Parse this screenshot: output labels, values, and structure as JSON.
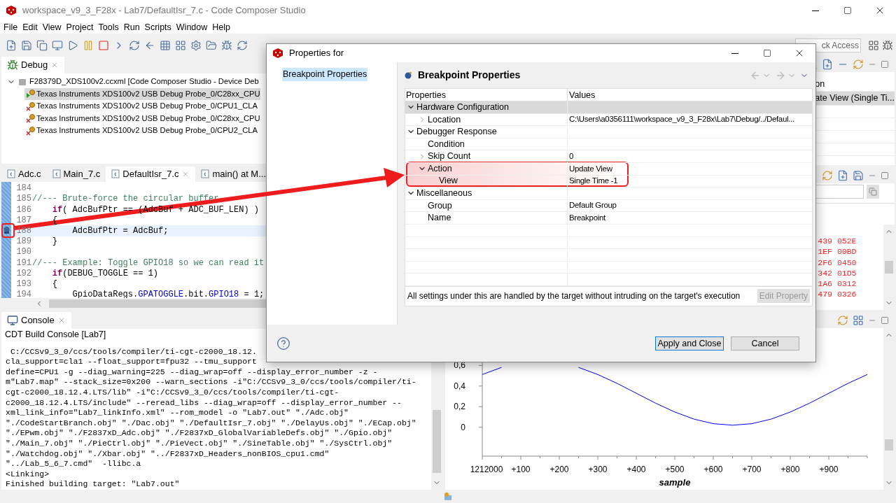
{
  "window": {
    "title": "workspace_v9_3_F28x - Lab7/DefaultIsr_7.c - Code Composer Studio"
  },
  "menu": [
    "File",
    "Edit",
    "View",
    "Project",
    "Tools",
    "Run",
    "Scripts",
    "Window",
    "Help"
  ],
  "quick_access": {
    "placeholder": "ck Access"
  },
  "debug_view": {
    "tab": "Debug",
    "root": {
      "label": "F28379D_XDS100v2.ccxml [Code Composer Studio - Device Deb",
      "expanded": true,
      "children": [
        {
          "label": "Texas Instruments XDS100v2 USB Debug Probe_0/C28xx_CPU",
          "selected": true,
          "kind": "running"
        },
        {
          "label": "Texas Instruments XDS100v2 USB Debug Probe_0/CPU1_CLA",
          "selected": false,
          "kind": "disconnected"
        },
        {
          "label": "Texas Instruments XDS100v2 USB Debug Probe_0/C28xx_CPU",
          "selected": false,
          "kind": "disconnected"
        },
        {
          "label": "Texas Instruments XDS100v2 USB Debug Probe_0/CPU2_CLA",
          "selected": false,
          "kind": "disconnected"
        }
      ]
    }
  },
  "editor": {
    "tabs": [
      {
        "label": "Adc.c",
        "selected": false
      },
      {
        "label": "Main_7.c",
        "selected": false
      },
      {
        "label": "DefaultIsr_7.c",
        "selected": true
      },
      {
        "label": "main() at M...",
        "selected": false
      }
    ],
    "lines": [
      {
        "number": "184",
        "current": false,
        "breakpoint": false
      },
      {
        "number": "185",
        "current": false,
        "breakpoint": false,
        "segments": [
          {
            "kind": "comment",
            "text": "//--- Brute-force the circular buffer"
          }
        ]
      },
      {
        "number": "186",
        "current": false,
        "breakpoint": false,
        "segments": [
          {
            "kind": "keyword",
            "text": "    if"
          },
          {
            "kind": "plain",
            "text": "( AdcBufPtr == (AdcBuf + ADC_BUF_LEN) )"
          }
        ]
      },
      {
        "number": "187",
        "current": false,
        "breakpoint": false,
        "segments": [
          {
            "kind": "plain",
            "text": "    {"
          }
        ]
      },
      {
        "number": "188",
        "current": true,
        "breakpoint": true,
        "segments": [
          {
            "kind": "plain",
            "text": "        AdcBufPtr = AdcBuf;"
          }
        ]
      },
      {
        "number": "189",
        "current": false,
        "breakpoint": false,
        "segments": [
          {
            "kind": "plain",
            "text": "    }"
          }
        ]
      },
      {
        "number": "190",
        "current": false,
        "breakpoint": false
      },
      {
        "number": "191",
        "current": false,
        "breakpoint": false,
        "segments": [
          {
            "kind": "comment",
            "text": "//--- Example: Toggle GPIO18 so we can read it"
          }
        ]
      },
      {
        "number": "192",
        "current": false,
        "breakpoint": false,
        "segments": [
          {
            "kind": "keyword",
            "text": "    if"
          },
          {
            "kind": "plain",
            "text": "(DEBUG_TOGGLE == 1)"
          }
        ]
      },
      {
        "number": "193",
        "current": false,
        "breakpoint": false,
        "segments": [
          {
            "kind": "plain",
            "text": "    {"
          }
        ]
      },
      {
        "number": "194",
        "current": false,
        "breakpoint": false,
        "segments": [
          {
            "kind": "plain",
            "text": "        GpioDataRegs."
          },
          {
            "kind": "field",
            "text": "GPATOGGLE"
          },
          {
            "kind": "plain",
            "text": ".bit."
          },
          {
            "kind": "field",
            "text": "GPIO18"
          },
          {
            "kind": "plain",
            "text": " = 1;"
          }
        ]
      }
    ]
  },
  "console": {
    "tab": "Console",
    "title": "CDT Build Console [Lab7]",
    "lines": [
      " C:/CCSv9_3_0/ccs/tools/compiler/ti-cgt-c2000_18.12.",
      "cla_support=cla1 --float_support=fpu32 --tmu_support",
      "define=CPU1 -g --diag_warning=225 --diag_wrap=off --display_error_number -z -",
      "m\"Lab7.map\" --stack_size=0x200 --warn_sections -i\"C:/CCSv9_3_0/ccs/tools/compiler/ti-",
      "cgt-c2000_18.12.4.LTS/lib\" -i\"C:/CCSv9_3_0/ccs/tools/compiler/ti-cgt-",
      "c2000_18.12.4.LTS/include\" --reread_libs --diag_wrap=off --display_error_number --",
      "xml_link_info=\"Lab7_linkInfo.xml\" --rom_model -o \"Lab7.out\" \"./Adc.obj\"",
      "\"./CodeStartBranch.obj\" \"./Dac.obj\" \"./DefaultIsr_7.obj\" \"./DelayUs.obj\" \"./ECap.obj\"",
      "\"./EPwm.obj\" \"./F2837xD_Adc.obj\" \"./F2837xD_GlobalVariableDefs.obj\" \"./Gpio.obj\"",
      "\"./Main_7.obj\" \"./PieCtrl.obj\" \"./PieVect.obj\" \"./SineTable.obj\" \"./SysCtrl.obj\"",
      "\"./Watchdog.obj\" \"./Xbar.obj\" \"../F2837xD_Headers_nonBIOS_cpu1.cmd\"",
      "\"../Lab_5_6_7.cmd\"  -llibc.a",
      "<Linking>",
      "Finished building target: \"Lab7.out\""
    ]
  },
  "breakpoints": {
    "rows": [
      {
        "text": "on",
        "selected": false
      },
      {
        "text": "ate View (Single Ti...",
        "selected": true
      }
    ]
  },
  "memory": {
    "rows": [
      "439 052E",
      "1EF 00BD",
      "2F6 0450",
      "342 01D5",
      "1A6 0312",
      "479 0326"
    ]
  },
  "graph": {
    "chart_data": {
      "type": "line",
      "xlabel": "sample",
      "ylim": [
        -0.28,
        0.65
      ],
      "categories": [
        "1212000",
        null,
        "+100",
        null,
        "+200",
        null,
        "+300",
        null,
        "+400",
        null,
        "+500",
        null,
        "+600",
        null,
        "+700",
        null,
        "+800",
        null,
        "+900",
        null,
        null
      ],
      "series": [
        {
          "color": "#0000ff",
          "values": [
            0.512,
            0.581,
            null,
            null,
            null,
            0.581,
            0.512,
            0.426,
            0.33,
            0.234,
            0.148,
            0.079,
            0.035,
            0.02,
            0.035,
            0.079,
            0.148,
            0.234,
            0.33,
            0.426,
            0.512
          ]
        }
      ],
      "yticks": [
        {
          "value": 0,
          "label": "0"
        },
        {
          "value": 0.2,
          "label": "0,2"
        },
        {
          "value": 0.4,
          "label": "0,4"
        },
        {
          "value": 0.6,
          "label": "0,6"
        }
      ]
    }
  },
  "dialog": {
    "title": "Properties for",
    "nav": [
      {
        "label": "Breakpoint Properties",
        "selected": true
      }
    ],
    "page_title": "Breakpoint Properties",
    "table": {
      "columns": [
        "Properties",
        "Values"
      ],
      "rows": [
        {
          "label": "Hardware Configuration",
          "expanded": true,
          "selected": true,
          "children": [
            {
              "label": "Location",
              "value": "C:\\Users\\a0356111\\workspace_v9_3_F28x\\Lab7\\Debug/../Defaul...",
              "expanded": false,
              "selected": false
            }
          ]
        },
        {
          "label": "Debugger Response",
          "expanded": true,
          "selected": false,
          "children": [
            {
              "label": "Condition",
              "selected": false
            },
            {
              "label": "Skip Count",
              "value": "0",
              "expanded": false,
              "selected": false
            },
            {
              "label": "Action",
              "value": "Update View",
              "expanded": true,
              "selected": false,
              "children": [
                {
                  "label": "View",
                  "value": "Single Time -1",
                  "selected": false
                }
              ]
            }
          ]
        },
        {
          "label": "Miscellaneous",
          "expanded": true,
          "selected": false,
          "children": [
            {
              "label": "Group",
              "value": "Default Group",
              "selected": false
            },
            {
              "label": "Name",
              "value": "Breakpoint",
              "selected": false
            }
          ]
        }
      ]
    },
    "description": "All settings under this are handled by the target without intruding on the target's execution",
    "edit_button": {
      "label": "Edit Property",
      "disabled": true
    },
    "buttons": [
      {
        "label": "Apply and Close",
        "default": true
      },
      {
        "label": "Cancel",
        "default": false
      }
    ]
  }
}
